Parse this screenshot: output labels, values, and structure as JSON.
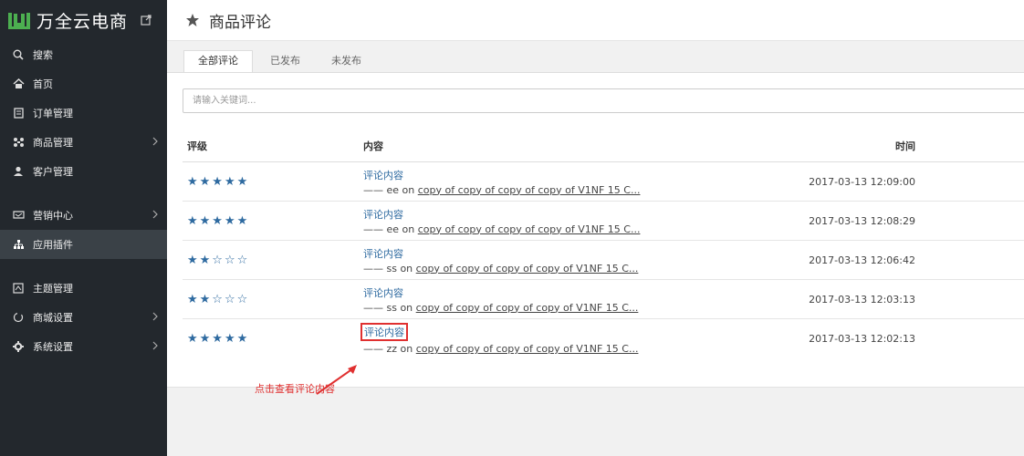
{
  "brand": {
    "name": "万全云电商"
  },
  "sidebar": {
    "items": [
      {
        "label": "搜索",
        "icon": "search-icon"
      },
      {
        "label": "首页",
        "icon": "home-icon"
      },
      {
        "label": "订单管理",
        "icon": "order-icon"
      },
      {
        "label": "商品管理",
        "icon": "product-icon"
      },
      {
        "label": "客户管理",
        "icon": "customer-icon"
      },
      {
        "label": "营销中心",
        "icon": "marketing-icon"
      },
      {
        "label": "应用插件",
        "icon": "plugin-icon"
      },
      {
        "label": "主题管理",
        "icon": "theme-icon"
      },
      {
        "label": "商城设置",
        "icon": "store-settings-icon"
      },
      {
        "label": "系统设置",
        "icon": "gear-icon"
      }
    ]
  },
  "header": {
    "title": "商品评论"
  },
  "tabs": [
    {
      "label": "全部评论"
    },
    {
      "label": "已发布"
    },
    {
      "label": "未发布"
    }
  ],
  "search": {
    "placeholder": "请输入关键词..."
  },
  "table": {
    "headers": {
      "rating": "评级",
      "content": "内容",
      "time": "时间"
    },
    "rows": [
      {
        "stars": 5,
        "title": "评论内容",
        "prefix": "—— ee on",
        "product": "copy of copy of copy of copy of V1NF 15 C...",
        "time": "2017-03-13 12:09:00"
      },
      {
        "stars": 5,
        "title": "评论内容",
        "prefix": "—— ee on",
        "product": "copy of copy of copy of copy of V1NF 15 C...",
        "time": "2017-03-13 12:08:29"
      },
      {
        "stars": 2,
        "title": "评论内容",
        "prefix": "—— ss on",
        "product": "copy of copy of copy of copy of V1NF 15 C...",
        "time": "2017-03-13 12:06:42"
      },
      {
        "stars": 2,
        "title": "评论内容",
        "prefix": "—— ss on",
        "product": "copy of copy of copy of copy of V1NF 15 C...",
        "time": "2017-03-13 12:03:13"
      },
      {
        "stars": 5,
        "title": "评论内容",
        "prefix": "—— zz on",
        "product": "copy of copy of copy of copy of V1NF 15 C...",
        "time": "2017-03-13 12:02:13"
      }
    ]
  },
  "annotation": {
    "text": "点击查看评论内容",
    "color": "#e03030"
  },
  "colors": {
    "sidebar": "#23282d",
    "link": "#2e6aa0",
    "brand_green": "#2ea44f"
  }
}
